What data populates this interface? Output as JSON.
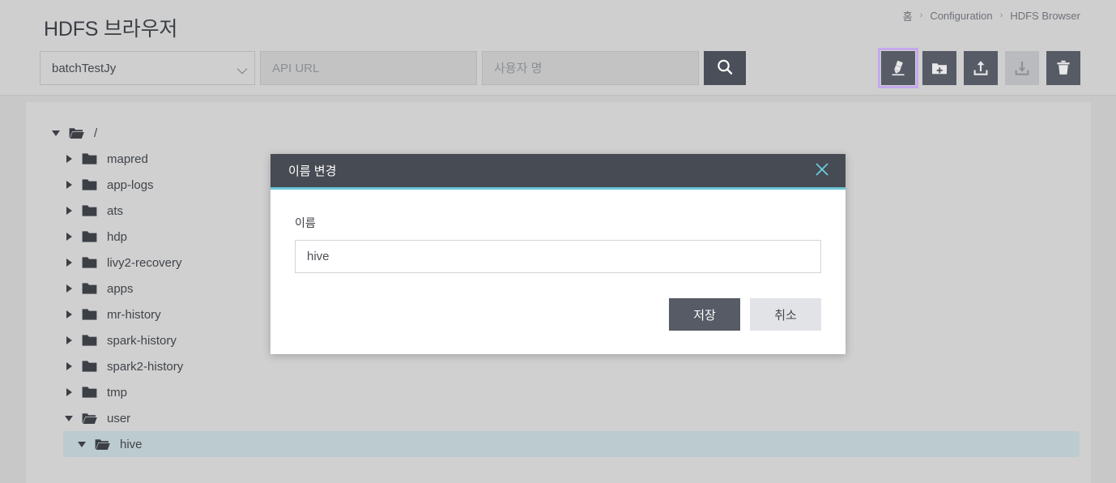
{
  "header": {
    "title": "HDFS 브라우저",
    "breadcrumb": [
      {
        "label": "홈"
      },
      {
        "label": "Configuration"
      },
      {
        "label": "HDFS Browser"
      }
    ],
    "breadcrumb_separator": "›"
  },
  "search": {
    "cluster_select_value": "batchTestJy",
    "api_url_placeholder": "API URL",
    "api_url_value": "",
    "username_placeholder": "사용자 명",
    "username_value": "",
    "search_icon": "search-icon"
  },
  "toolbar": {
    "buttons": [
      {
        "name": "rename-button",
        "icon": "pencil-icon",
        "state": "focused"
      },
      {
        "name": "new-folder-button",
        "icon": "folder-plus-icon",
        "state": "enabled"
      },
      {
        "name": "upload-button",
        "icon": "upload-icon",
        "state": "enabled"
      },
      {
        "name": "download-button",
        "icon": "download-icon",
        "state": "disabled"
      },
      {
        "name": "delete-button",
        "icon": "trash-icon",
        "state": "enabled"
      }
    ]
  },
  "tree": {
    "nodes": [
      {
        "label": "/",
        "depth": 0,
        "expanded": true,
        "open_folder": true,
        "selected": false
      },
      {
        "label": "mapred",
        "depth": 1,
        "expanded": false,
        "open_folder": false,
        "selected": false
      },
      {
        "label": "app-logs",
        "depth": 1,
        "expanded": false,
        "open_folder": false,
        "selected": false
      },
      {
        "label": "ats",
        "depth": 1,
        "expanded": false,
        "open_folder": false,
        "selected": false
      },
      {
        "label": "hdp",
        "depth": 1,
        "expanded": false,
        "open_folder": false,
        "selected": false
      },
      {
        "label": "livy2-recovery",
        "depth": 1,
        "expanded": false,
        "open_folder": false,
        "selected": false
      },
      {
        "label": "apps",
        "depth": 1,
        "expanded": false,
        "open_folder": false,
        "selected": false
      },
      {
        "label": "mr-history",
        "depth": 1,
        "expanded": false,
        "open_folder": false,
        "selected": false
      },
      {
        "label": "spark-history",
        "depth": 1,
        "expanded": false,
        "open_folder": false,
        "selected": false
      },
      {
        "label": "spark2-history",
        "depth": 1,
        "expanded": false,
        "open_folder": false,
        "selected": false
      },
      {
        "label": "tmp",
        "depth": 1,
        "expanded": false,
        "open_folder": false,
        "selected": false
      },
      {
        "label": "user",
        "depth": 1,
        "expanded": true,
        "open_folder": true,
        "selected": false
      },
      {
        "label": "hive",
        "depth": 2,
        "expanded": true,
        "open_folder": true,
        "selected": true
      }
    ]
  },
  "modal": {
    "title": "이름 변경",
    "close_icon": "close-icon",
    "name_label": "이름",
    "name_value": "hive",
    "name_placeholder": "",
    "save_label": "저장",
    "cancel_label": "취소"
  },
  "colors": {
    "page_background": "#c8c8c8",
    "panel_background": "#d0d0d0",
    "header_background": "#cfcfcf",
    "accent_teal": "#6bc6d8",
    "modal_header": "#474b53",
    "toolbar_button": "#565b65",
    "toolbar_button_disabled": "#b9bbbf",
    "focus_ring": "#c5a9ec",
    "tree_selected": "#bccbcf",
    "save_button": "#565b65",
    "cancel_button": "#e1e3e7"
  }
}
